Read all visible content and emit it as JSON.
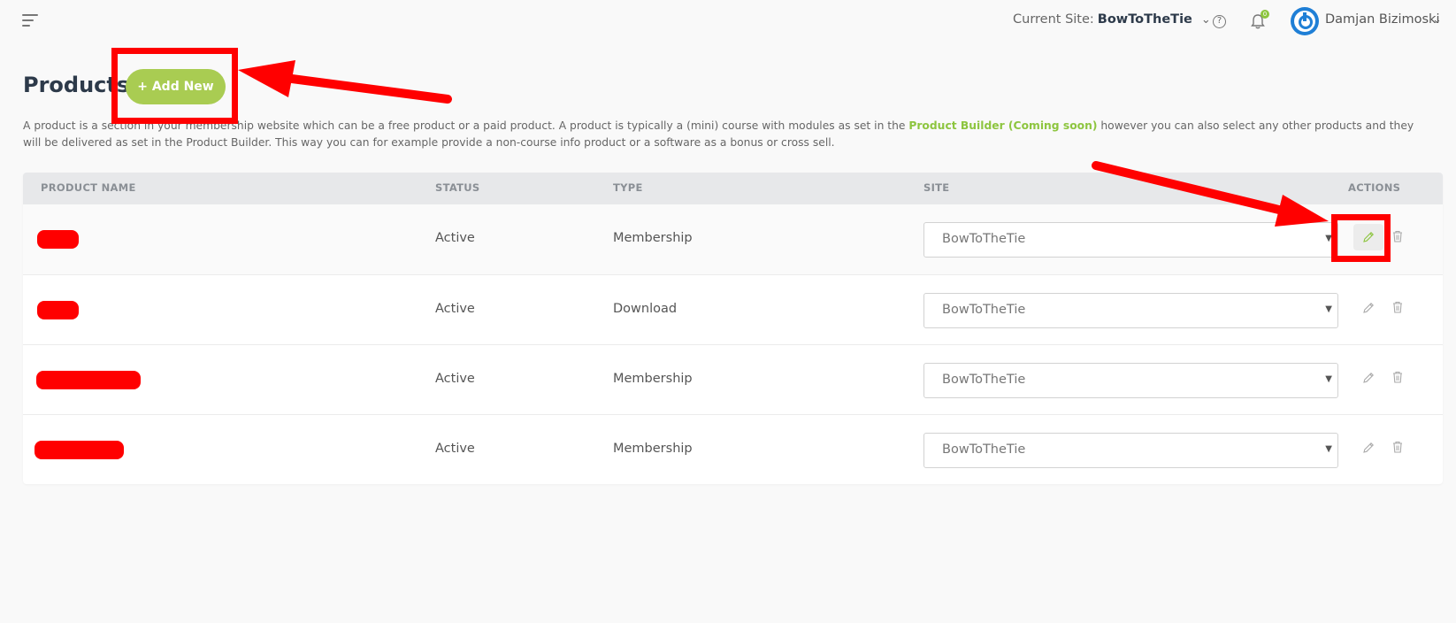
{
  "topbar": {
    "menu_icon": "hamburger-icon",
    "current_site_label": "Current Site:",
    "current_site_name": "BowToTheTie",
    "help_icon_glyph": "?",
    "notification_count": "0",
    "user_name": "Damjan Bizimoski"
  },
  "page": {
    "title": "Products",
    "add_new_label": "+ Add New",
    "description_before": "A product is a section in your membership website which can be a free product or a paid product. A product is typically a (mini) course with modules as set in the ",
    "description_link": "Product Builder (Coming soon)",
    "description_after": " however you can also select any other products and they will be delivered as set in the Product Builder. This way you can for example provide a non-course info product or a software as a bonus or cross sell."
  },
  "table": {
    "headers": {
      "name": "PRODUCT NAME",
      "status": "STATUS",
      "type": "TYPE",
      "site": "SITE",
      "actions": "ACTIONS"
    },
    "rows": [
      {
        "status": "Active",
        "type": "Membership",
        "site": "BowToTheTie"
      },
      {
        "status": "Active",
        "type": "Download",
        "site": "BowToTheTie"
      },
      {
        "status": "Active",
        "type": "Membership",
        "site": "BowToTheTie"
      },
      {
        "status": "Active",
        "type": "Membership",
        "site": "BowToTheTie"
      }
    ]
  },
  "colors": {
    "accent_green": "#a9cc52",
    "link_green": "#8dc53f",
    "annotation_red": "#ff0000",
    "avatar_blue": "#1f7fd6"
  }
}
